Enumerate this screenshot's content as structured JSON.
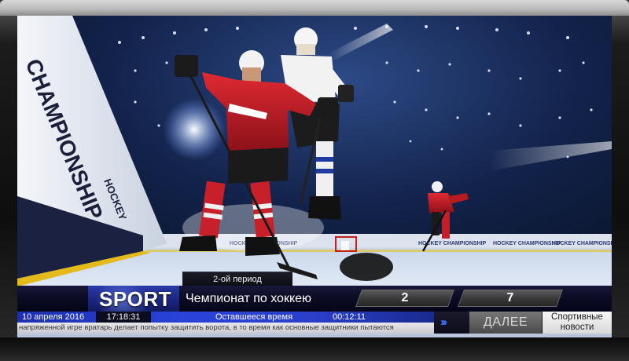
{
  "broadcast": {
    "period": "2-ой период",
    "brand": "SPORT",
    "event_title": "Чемпионат по хоккею",
    "score_home": "2",
    "score_away": "7",
    "date": "10 апреля 2016",
    "clock": "17:18:31",
    "remaining_label": "Оставшееся время",
    "remaining_time": "00:12:11",
    "ticker": "напряженной игре вратарь делает попытку защитить ворота, в то время как основные защитники пытаются",
    "next_label": "ДАЛЕЕ",
    "next_chevrons": "›››",
    "news_label_line1": "Спортивные",
    "news_label_line2": "новости"
  },
  "scene": {
    "boards_text_left": "CHAMPIONSHIP",
    "boards_text_small": "HOCKEY CHAMPIONSHIP",
    "colors": {
      "accent_blue": "#2a42d8",
      "home_jersey": "#c8202a",
      "away_jersey": "#f2f2f2"
    }
  },
  "icons": {
    "next": "chevron-right-icon",
    "goal": "hockey-goal-icon"
  }
}
